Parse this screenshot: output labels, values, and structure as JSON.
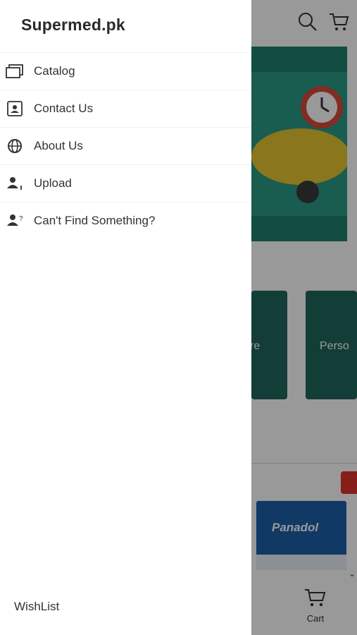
{
  "drawer": {
    "brand": "Supermed.pk",
    "menu": [
      {
        "label": "Catalog",
        "icon": "catalog-icon"
      },
      {
        "label": "Contact Us",
        "icon": "contact-card-icon"
      },
      {
        "label": "About Us",
        "icon": "globe-icon"
      },
      {
        "label": "Upload",
        "icon": "user-upload-icon"
      },
      {
        "label": "Can't Find Something?",
        "icon": "user-question-icon"
      }
    ],
    "wishlist_label": "WishList"
  },
  "background": {
    "categories": [
      "re",
      "Perso"
    ],
    "product_brand": "Panadol",
    "cart_label": "Cart",
    "colors": {
      "banner": "#1f7f6f",
      "category_card": "#21665c",
      "sale_badge": "#e0322e",
      "overlay": "rgba(0,0,0,0.40)"
    }
  }
}
